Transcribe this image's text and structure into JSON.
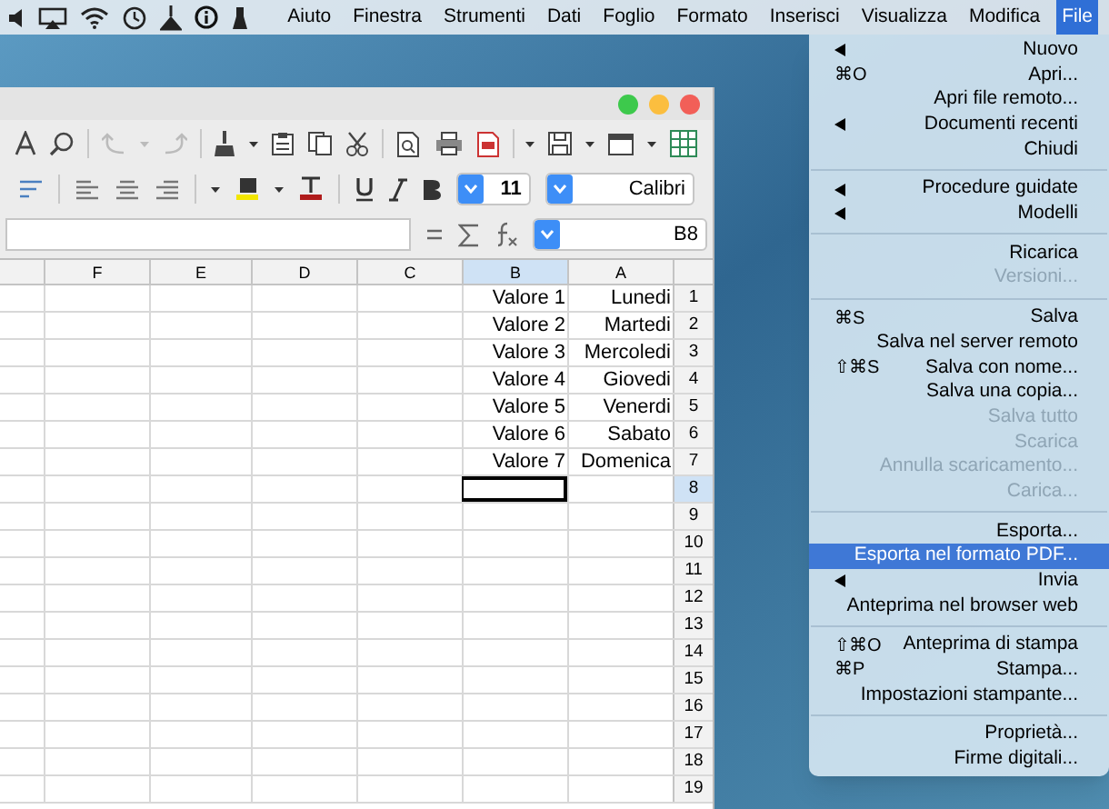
{
  "menubar": {
    "items": [
      {
        "label": "Aiuto",
        "selected": false
      },
      {
        "label": "Finestra",
        "selected": false
      },
      {
        "label": "Strumenti",
        "selected": false
      },
      {
        "label": "Dati",
        "selected": false
      },
      {
        "label": "Foglio",
        "selected": false
      },
      {
        "label": "Formato",
        "selected": false
      },
      {
        "label": "Inserisci",
        "selected": false
      },
      {
        "label": "Visualizza",
        "selected": false
      },
      {
        "label": "Modifica",
        "selected": false
      },
      {
        "label": "File",
        "selected": true
      }
    ]
  },
  "spreadsheet": {
    "font_name": "Calibri",
    "font_size": "11",
    "name_box": "B8",
    "columns": [
      {
        "label": "F",
        "selected": false
      },
      {
        "label": "E",
        "selected": false
      },
      {
        "label": "D",
        "selected": false
      },
      {
        "label": "C",
        "selected": false
      },
      {
        "label": "B",
        "selected": true
      },
      {
        "label": "A",
        "selected": false
      }
    ],
    "rows": [
      {
        "label": "1",
        "selected": false,
        "cells": [
          "Valore 1",
          "Lunedi"
        ]
      },
      {
        "label": "2",
        "selected": false,
        "cells": [
          "Valore 2",
          "Martedi"
        ]
      },
      {
        "label": "3",
        "selected": false,
        "cells": [
          "Valore 3",
          "Mercoledi"
        ]
      },
      {
        "label": "4",
        "selected": false,
        "cells": [
          "Valore 4",
          "Giovedi"
        ]
      },
      {
        "label": "5",
        "selected": false,
        "cells": [
          "Valore 5",
          "Venerdi"
        ]
      },
      {
        "label": "6",
        "selected": false,
        "cells": [
          "Valore 6",
          "Sabato"
        ]
      },
      {
        "label": "7",
        "selected": false,
        "cells": [
          "Valore 7",
          "Domenica"
        ]
      },
      {
        "label": "8",
        "selected": true
      },
      {
        "label": "9",
        "selected": false
      },
      {
        "label": "10",
        "selected": false
      },
      {
        "label": "11",
        "selected": false
      },
      {
        "label": "12",
        "selected": false
      },
      {
        "label": "13",
        "selected": false
      },
      {
        "label": "14",
        "selected": false
      },
      {
        "label": "15",
        "selected": false
      },
      {
        "label": "16",
        "selected": false
      },
      {
        "label": "17",
        "selected": false
      },
      {
        "label": "18",
        "selected": false
      },
      {
        "label": "19",
        "selected": false
      }
    ]
  },
  "file_menu": {
    "groups": [
      [
        {
          "label": "Nuovo",
          "submenu": true,
          "disabled": false,
          "selected": false
        },
        {
          "label": "Apri...",
          "shortcut": "⌘O",
          "submenu": false,
          "disabled": false,
          "selected": false
        },
        {
          "label": "Apri file remoto...",
          "submenu": false,
          "disabled": false,
          "selected": false
        },
        {
          "label": "Documenti recenti",
          "submenu": true,
          "disabled": false,
          "selected": false
        },
        {
          "label": "Chiudi",
          "submenu": false,
          "disabled": false,
          "selected": false
        }
      ],
      [
        {
          "label": "Procedure guidate",
          "submenu": true,
          "disabled": false,
          "selected": false
        },
        {
          "label": "Modelli",
          "submenu": true,
          "disabled": false,
          "selected": false
        }
      ],
      [
        {
          "label": "Ricarica",
          "submenu": false,
          "disabled": false,
          "selected": false
        },
        {
          "label": "Versioni...",
          "submenu": false,
          "disabled": true,
          "selected": false
        }
      ],
      [
        {
          "label": "Salva",
          "shortcut": "⌘S",
          "submenu": false,
          "disabled": false,
          "selected": false
        },
        {
          "label": "Salva nel server remoto",
          "submenu": false,
          "disabled": false,
          "selected": false
        },
        {
          "label": "Salva con nome...",
          "shortcut": "⇧⌘S",
          "submenu": false,
          "disabled": false,
          "selected": false
        },
        {
          "label": "Salva una copia...",
          "submenu": false,
          "disabled": false,
          "selected": false
        },
        {
          "label": "Salva tutto",
          "submenu": false,
          "disabled": true,
          "selected": false
        },
        {
          "label": "Scarica",
          "submenu": false,
          "disabled": true,
          "selected": false
        },
        {
          "label": "Annulla scaricamento...",
          "submenu": false,
          "disabled": true,
          "selected": false
        },
        {
          "label": "Carica...",
          "submenu": false,
          "disabled": true,
          "selected": false
        }
      ],
      [
        {
          "label": "Esporta...",
          "submenu": false,
          "disabled": false,
          "selected": false
        },
        {
          "label": "Esporta nel formato PDF...",
          "submenu": false,
          "disabled": false,
          "selected": true
        },
        {
          "label": "Invia",
          "submenu": true,
          "disabled": false,
          "selected": false
        },
        {
          "label": "Anteprima nel browser web",
          "submenu": false,
          "disabled": false,
          "selected": false
        }
      ],
      [
        {
          "label": "Anteprima di stampa",
          "shortcut": "⇧⌘O",
          "submenu": false,
          "disabled": false,
          "selected": false
        },
        {
          "label": "Stampa...",
          "shortcut": "⌘P",
          "submenu": false,
          "disabled": false,
          "selected": false
        },
        {
          "label": "Impostazioni stampante...",
          "submenu": false,
          "disabled": false,
          "selected": false
        }
      ],
      [
        {
          "label": "Proprietà...",
          "submenu": false,
          "disabled": false,
          "selected": false
        },
        {
          "label": "Firme digitali...",
          "submenu": false,
          "disabled": false,
          "selected": false
        }
      ]
    ]
  }
}
